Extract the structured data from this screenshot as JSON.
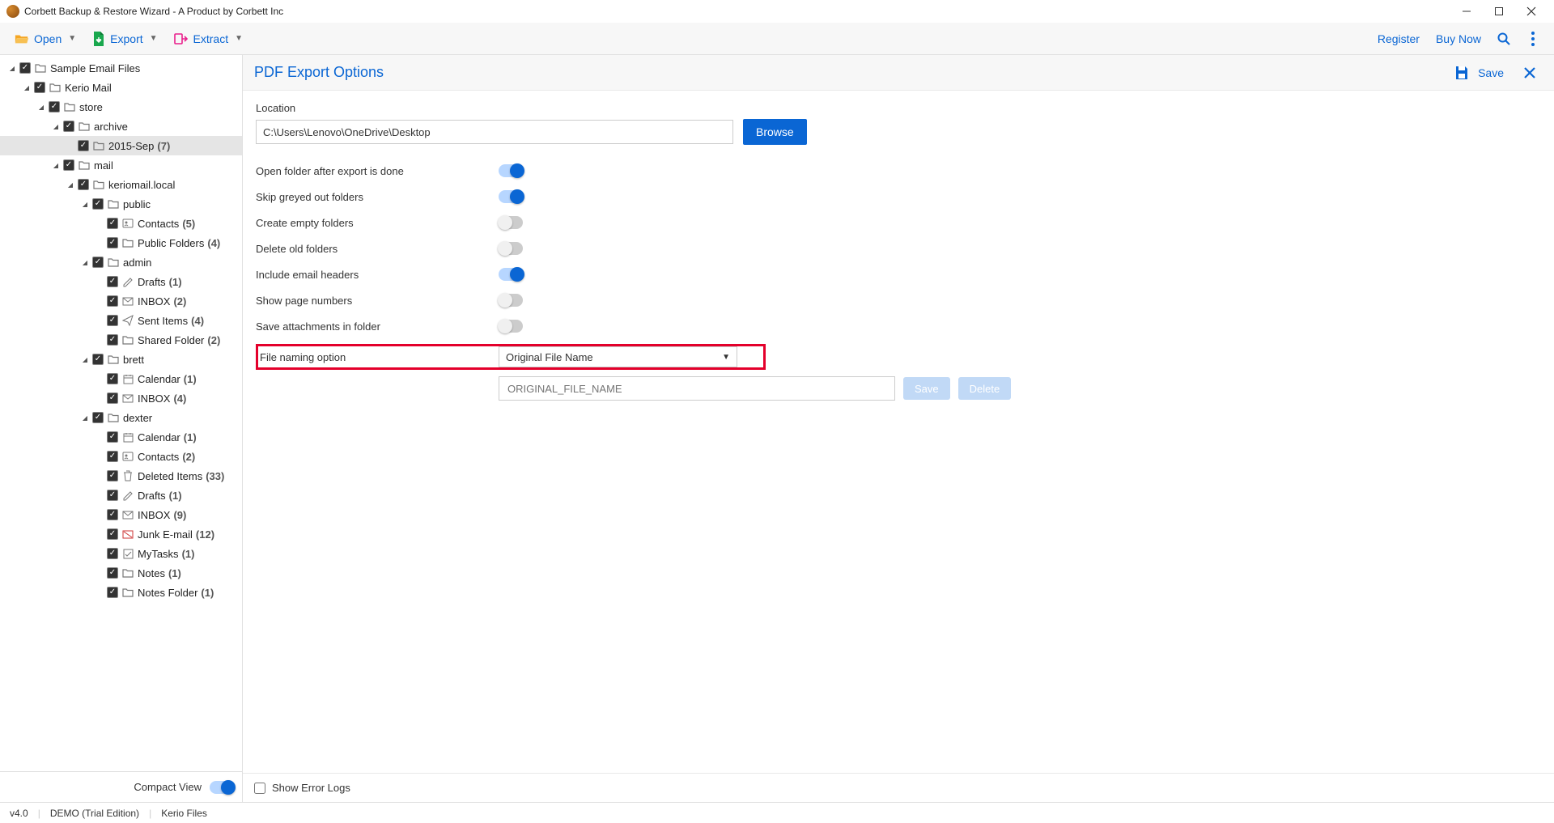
{
  "window": {
    "title": "Corbett Backup & Restore Wizard - A Product by Corbett Inc"
  },
  "toolbar": {
    "open": "Open",
    "export": "Export",
    "extract": "Extract",
    "register": "Register",
    "buynow": "Buy Now"
  },
  "sidebar": {
    "compact_view": "Compact View"
  },
  "tree": [
    {
      "depth": 0,
      "expanded": true,
      "icon": "folder",
      "label": "Sample Email Files",
      "count": null
    },
    {
      "depth": 1,
      "expanded": true,
      "icon": "folder",
      "label": "Kerio Mail",
      "count": null
    },
    {
      "depth": 2,
      "expanded": true,
      "icon": "folder",
      "label": "store",
      "count": null
    },
    {
      "depth": 3,
      "expanded": true,
      "icon": "folder",
      "label": "archive",
      "count": null
    },
    {
      "depth": 4,
      "expanded": null,
      "icon": "folder",
      "label": "2015-Sep",
      "count": "(7)",
      "selected": true
    },
    {
      "depth": 3,
      "expanded": true,
      "icon": "folder",
      "label": "mail",
      "count": null
    },
    {
      "depth": 4,
      "expanded": true,
      "icon": "folder",
      "label": "keriomail.local",
      "count": null
    },
    {
      "depth": 5,
      "expanded": true,
      "icon": "folder",
      "label": "public",
      "count": null
    },
    {
      "depth": 6,
      "expanded": null,
      "icon": "contacts",
      "label": "Contacts",
      "count": "(5)"
    },
    {
      "depth": 6,
      "expanded": null,
      "icon": "folder",
      "label": "Public Folders",
      "count": "(4)"
    },
    {
      "depth": 5,
      "expanded": true,
      "icon": "folder",
      "label": "admin",
      "count": null
    },
    {
      "depth": 6,
      "expanded": null,
      "icon": "drafts",
      "label": "Drafts",
      "count": "(1)"
    },
    {
      "depth": 6,
      "expanded": null,
      "icon": "inbox",
      "label": "INBOX",
      "count": "(2)"
    },
    {
      "depth": 6,
      "expanded": null,
      "icon": "sent",
      "label": "Sent Items",
      "count": "(4)"
    },
    {
      "depth": 6,
      "expanded": null,
      "icon": "folder",
      "label": "Shared Folder",
      "count": "(2)"
    },
    {
      "depth": 5,
      "expanded": true,
      "icon": "folder",
      "label": "brett",
      "count": null
    },
    {
      "depth": 6,
      "expanded": null,
      "icon": "calendar",
      "label": "Calendar",
      "count": "(1)"
    },
    {
      "depth": 6,
      "expanded": null,
      "icon": "inbox",
      "label": "INBOX",
      "count": "(4)"
    },
    {
      "depth": 5,
      "expanded": true,
      "icon": "folder",
      "label": "dexter",
      "count": null
    },
    {
      "depth": 6,
      "expanded": null,
      "icon": "calendar",
      "label": "Calendar",
      "count": "(1)"
    },
    {
      "depth": 6,
      "expanded": null,
      "icon": "contacts",
      "label": "Contacts",
      "count": "(2)"
    },
    {
      "depth": 6,
      "expanded": null,
      "icon": "trash",
      "label": "Deleted Items",
      "count": "(33)"
    },
    {
      "depth": 6,
      "expanded": null,
      "icon": "drafts",
      "label": "Drafts",
      "count": "(1)"
    },
    {
      "depth": 6,
      "expanded": null,
      "icon": "inbox",
      "label": "INBOX",
      "count": "(9)"
    },
    {
      "depth": 6,
      "expanded": null,
      "icon": "junk",
      "label": "Junk E-mail",
      "count": "(12)"
    },
    {
      "depth": 6,
      "expanded": null,
      "icon": "tasks",
      "label": "MyTasks",
      "count": "(1)"
    },
    {
      "depth": 6,
      "expanded": null,
      "icon": "folder",
      "label": "Notes",
      "count": "(1)"
    },
    {
      "depth": 6,
      "expanded": null,
      "icon": "folder",
      "label": "Notes Folder",
      "count": "(1)"
    }
  ],
  "main": {
    "title": "PDF Export Options",
    "save": "Save",
    "location_label": "Location",
    "location_value": "C:\\Users\\Lenovo\\OneDrive\\Desktop",
    "browse": "Browse",
    "options": {
      "open_after": {
        "label": "Open folder after export is done",
        "on": true
      },
      "skip_grey": {
        "label": "Skip greyed out folders",
        "on": true
      },
      "empty": {
        "label": "Create empty folders",
        "on": false
      },
      "delete_old": {
        "label": "Delete old folders",
        "on": false
      },
      "headers": {
        "label": "Include email headers",
        "on": true
      },
      "page_nums": {
        "label": "Show page numbers",
        "on": false
      },
      "attachments": {
        "label": "Save attachments in folder",
        "on": false
      }
    },
    "file_naming_label": "File naming option",
    "file_naming_value": "Original File Name",
    "name_placeholder": "ORIGINAL_FILE_NAME",
    "save_btn": "Save",
    "delete_btn": "Delete",
    "show_error_logs": "Show Error Logs"
  },
  "status": {
    "version": "v4.0",
    "edition": "DEMO (Trial Edition)",
    "files": "Kerio Files"
  }
}
